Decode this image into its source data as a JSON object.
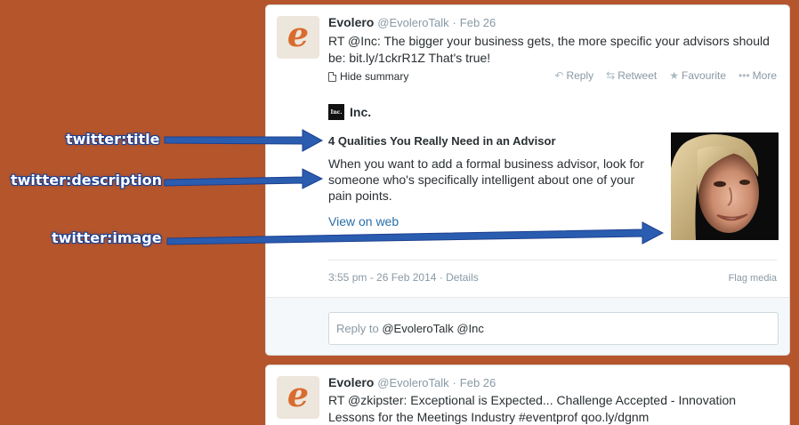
{
  "annotations": {
    "title_label": "twitter:title",
    "description_label": "twitter:description",
    "image_label": "twitter:image"
  },
  "tweet1": {
    "name": "Evolero",
    "handle": "@EvoleroTalk",
    "separator": "·",
    "date": "Feb 26",
    "text": "RT @Inc: The bigger your business gets, the more specific your advisors should be: bit.ly/1ckrR1Z That's true!",
    "hide_summary": "Hide summary",
    "actions": {
      "reply": "Reply",
      "retweet": "Retweet",
      "favourite": "Favourite",
      "more": "More"
    },
    "card": {
      "source_logo": "Inc.",
      "source_name": "Inc.",
      "title": "4 Qualities You Really Need in an Advisor",
      "description": "When you want to add a formal business advisor, look for someone who's specifically intelligent about one of your pain points.",
      "view_on_web": "View on web"
    },
    "timestamp": "3:55 pm - 26 Feb 2014 · Details",
    "flag_media": "Flag media",
    "reply_prefix": "Reply to",
    "reply_mentions": "@EvoleroTalk @Inc"
  },
  "tweet2": {
    "name": "Evolero",
    "handle": "@EvoleroTalk",
    "separator": "·",
    "date": "Feb 26",
    "text": "RT @zkipster: Exceptional is Expected... Challenge Accepted - Innovation Lessons for the Meetings Industry #eventprof qoo.ly/dgnm"
  },
  "colors": {
    "background": "#b4552c",
    "arrow": "#2a5db0",
    "link": "#2a6fa8",
    "avatar_accent": "#d96b2f"
  },
  "icons": {
    "reply": "reply-arrow-icon",
    "retweet": "retweet-icon",
    "favourite": "star-icon",
    "more": "ellipsis-icon",
    "summary": "document-icon"
  }
}
